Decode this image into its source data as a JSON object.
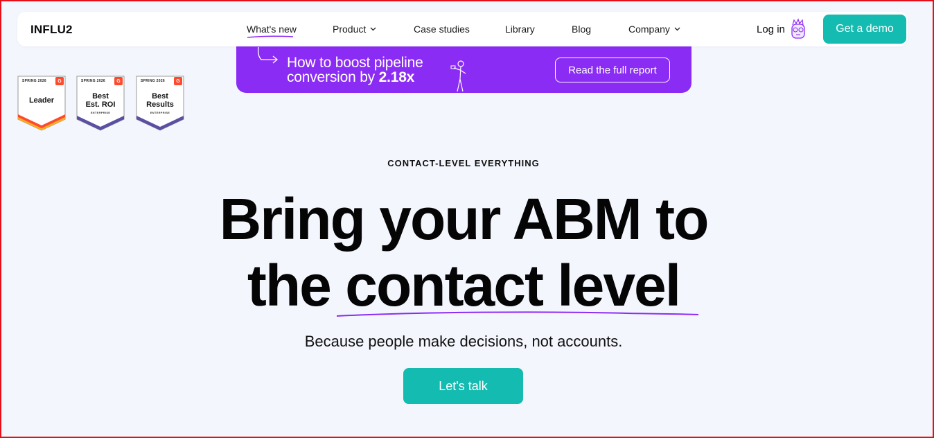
{
  "nav": {
    "logo": "INFLU2",
    "items": [
      {
        "label": "What's new",
        "has_dropdown": false
      },
      {
        "label": "Product",
        "has_dropdown": true
      },
      {
        "label": "Case studies",
        "has_dropdown": false
      },
      {
        "label": "Library",
        "has_dropdown": false
      },
      {
        "label": "Blog",
        "has_dropdown": false
      },
      {
        "label": "Company",
        "has_dropdown": true
      }
    ],
    "login": "Log in",
    "demo": "Get a demo"
  },
  "promo": {
    "line1": "How to boost pipeline",
    "line2_prefix": "conversion by ",
    "line2_bold": "2.18x",
    "button": "Read the full report"
  },
  "badges": [
    {
      "season": "SPRING 2026",
      "title_line1": "Leader",
      "title_line2": "",
      "sub": ""
    },
    {
      "season": "SPRING 2026",
      "title_line1": "Best",
      "title_line2": "Est. ROI",
      "sub": "ENTERPRISE"
    },
    {
      "season": "SPRING 2026",
      "title_line1": "Best",
      "title_line2": "Results",
      "sub": "ENTERPRISE"
    }
  ],
  "hero": {
    "eyebrow": "CONTACT-LEVEL EVERYTHING",
    "headline_line1": "Bring your ABM to",
    "headline_line2": "the contact level",
    "subline": "Because people make decisions, not accounts.",
    "cta": "Let's talk"
  },
  "colors": {
    "accent": "#14bbb0",
    "promo_bg": "#8b2cf5",
    "page_bg": "#f3f6fd",
    "underline": "#8b2cf5",
    "g2_red": "#ff492c"
  }
}
